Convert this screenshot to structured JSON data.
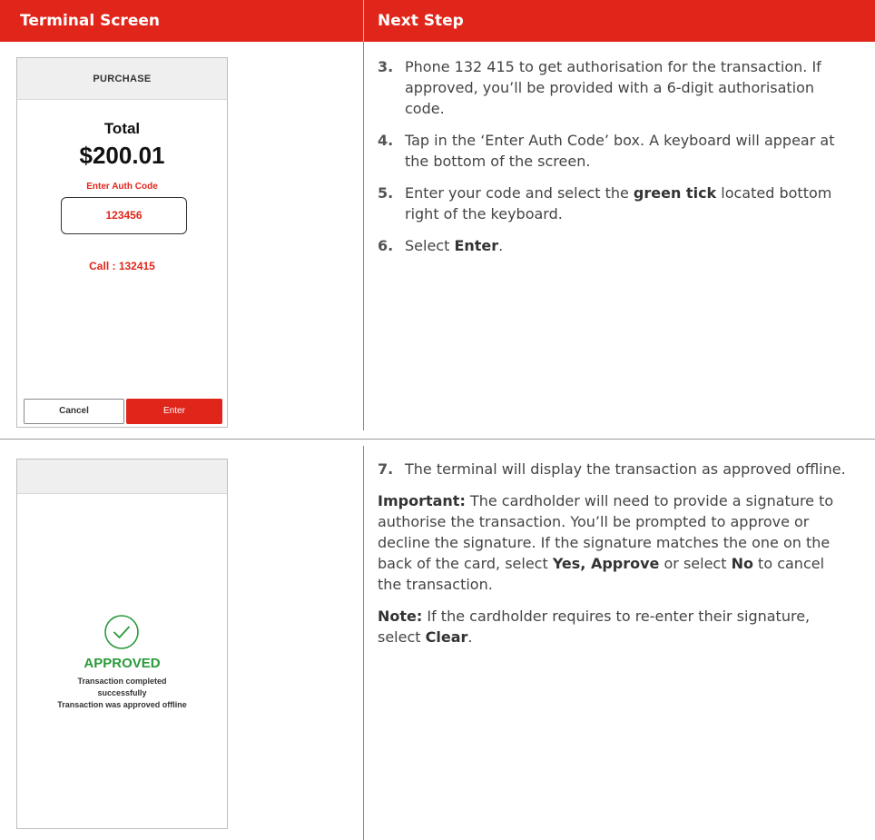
{
  "header": {
    "col_left": "Terminal Screen",
    "col_right": "Next Step"
  },
  "terminal1": {
    "top_label": "PURCHASE",
    "total_label": "Total",
    "amount": "$200.01",
    "auth_label": "Enter Auth Code",
    "auth_value": "123456",
    "call_text": "Call : 132415",
    "cancel_label": "Cancel",
    "enter_label": "Enter"
  },
  "terminal2": {
    "top_label": "",
    "status": "APPROVED",
    "msg_line1": "Transaction completed",
    "msg_line2": "successfully",
    "msg_line3": "Transaction was approved offline",
    "icon": "check-circle-icon"
  },
  "steps1": {
    "s3_num": "3.",
    "s3_text": "Phone 132 415 to get authorisation for the transaction. If approved, you’ll be provided with a 6-digit authorisation code.",
    "s4_num": "4.",
    "s4_text": "Tap in the ‘Enter Auth Code’ box. A keyboard will appear at the bottom of the screen.",
    "s5_num": "5.",
    "s5_pre": "Enter your code and select the ",
    "s5_bold": "green tick",
    "s5_post": " located bottom right of the keyboard.",
    "s6_num": "6.",
    "s6_pre": "Select ",
    "s6_bold": "Enter",
    "s6_post": "."
  },
  "steps2": {
    "s7_num": "7.",
    "s7_text": "The terminal will display the transaction as approved offline.",
    "important_label": "Important:",
    "important_pre": " The cardholder will need to provide a signature to authorise the transaction. You’ll be prompted to approve or decline the signature. If the signature matches the one on the back of the card, select ",
    "important_bold1": "Yes, Approve",
    "important_mid": " or select ",
    "important_bold2": "No",
    "important_post": " to cancel the transaction.",
    "note_label": "Note:",
    "note_pre": " If the cardholder requires to re-enter their signature, select ",
    "note_bold": "Clear",
    "note_post": "."
  },
  "colors": {
    "brand_red": "#e0261b",
    "approved_green": "#2a9a3a"
  }
}
